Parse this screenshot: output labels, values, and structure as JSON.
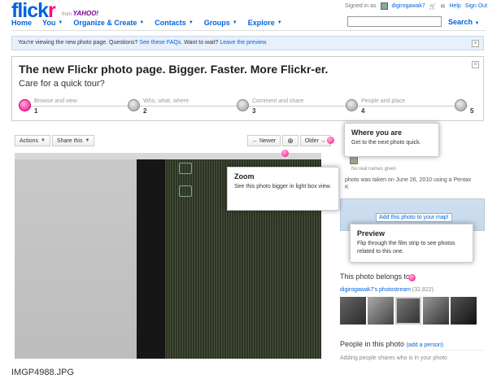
{
  "header": {
    "logo_blue": "flick",
    "logo_pink": "r",
    "from_text": "from",
    "yahoo": "YAHOO!",
    "nav": [
      {
        "label": "Home",
        "caret": false
      },
      {
        "label": "You",
        "caret": true
      },
      {
        "label": "Organize & Create",
        "caret": true
      },
      {
        "label": "Contacts",
        "caret": true
      },
      {
        "label": "Groups",
        "caret": true
      },
      {
        "label": "Explore",
        "caret": true
      }
    ],
    "signed_in_as": "Signed in as",
    "username": "digirogawak7",
    "help": "Help",
    "sign_out": "Sign Out",
    "search_label": "Search",
    "search_value": ""
  },
  "notice": {
    "text": "You're viewing the new photo page. Questions?",
    "faq_link": "See these FAQs.",
    "wait_text": "Want to wait?",
    "leave_link": "Leave the preview."
  },
  "tour": {
    "title": "The new Flickr photo page. Bigger. Faster. More Flickr-er.",
    "subtitle": "Care for a quick tour?",
    "steps": [
      {
        "label": "Browse and view",
        "num": "1"
      },
      {
        "label": "Who, what, where",
        "num": "2"
      },
      {
        "label": "Comment and share",
        "num": "3"
      },
      {
        "label": "People and place",
        "num": "4"
      },
      {
        "label": "",
        "num": "5"
      }
    ]
  },
  "toolbar": {
    "actions": "Actions",
    "share": "Share this",
    "newer": "← Newer",
    "older": "Older →"
  },
  "photo": {
    "filename": "IMGP4988.JPG"
  },
  "sidebar": {
    "no_names": "No real names given",
    "taken_text": "photo was taken on June 26, 2010 using a Pentax",
    "taken_tail": "K",
    "map_link": "Add this photo to your map!",
    "belongs": "This photo belongs to",
    "stream_link": "digirogawak7's photostream",
    "stream_count": "(32,822)",
    "people_title": "People in this photo",
    "add_person": "(add a person)",
    "people_help": "Adding people shares who is in your photo"
  },
  "tips": {
    "where": {
      "title": "Where you are",
      "body": "Get to the next photo quick."
    },
    "zoom": {
      "title": "Zoom",
      "body": "See this photo bigger in light box view."
    },
    "preview": {
      "title": "Preview",
      "body": "Flip through the film strip to see photos related to this one."
    }
  }
}
